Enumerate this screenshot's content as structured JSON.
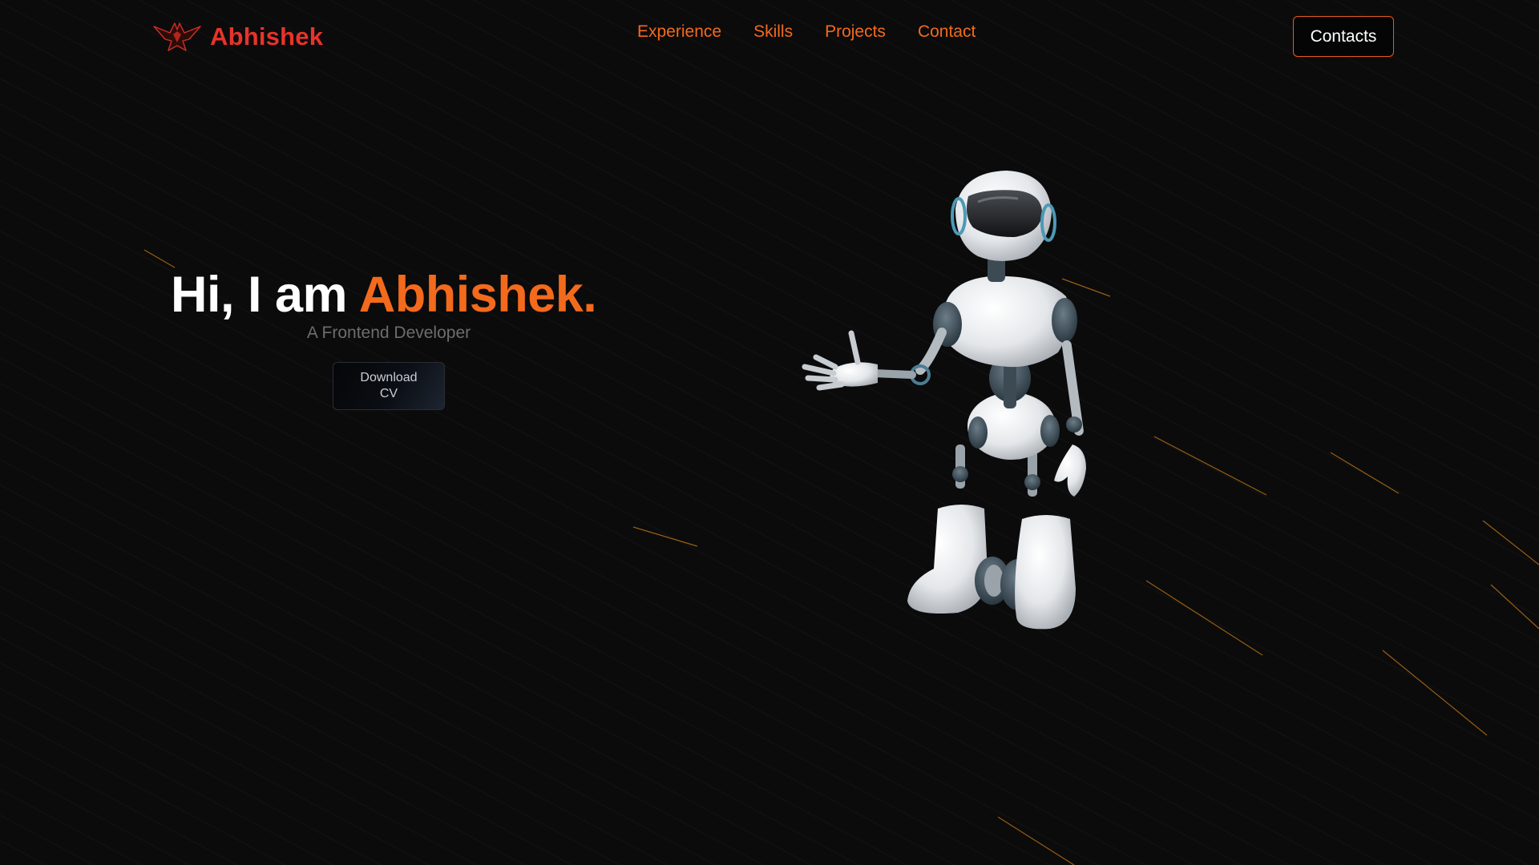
{
  "navbar": {
    "brand_name": "Abhishek",
    "brand_icon": "eagle-logo-icon",
    "links": [
      {
        "label": "Experience"
      },
      {
        "label": "Skills"
      },
      {
        "label": "Projects"
      },
      {
        "label": "Contact"
      }
    ],
    "contacts_button": "Contacts"
  },
  "hero": {
    "greeting": "Hi, I am ",
    "name": "Abhishek.",
    "subtitle": "A Frontend Developer",
    "download_button": "Download CV",
    "image": "robot-illustration"
  },
  "colors": {
    "background": "#0b0b0c",
    "brand_red": "#e8332a",
    "accent_orange": "#f36a1c",
    "text_white": "#ffffff",
    "text_muted": "#6d6d70"
  }
}
